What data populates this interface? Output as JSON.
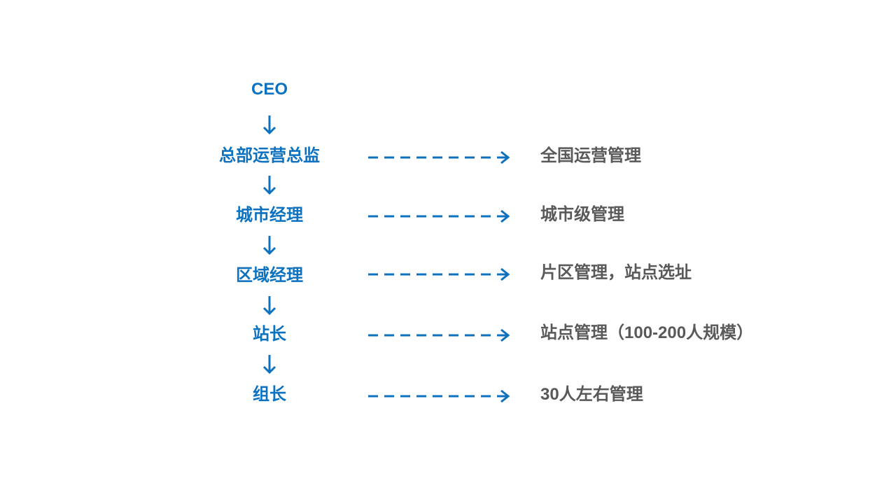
{
  "colors": {
    "role_text": "#0c72c0",
    "arrow": "#0c72c0",
    "description_text": "#595959",
    "background": "#ffffff"
  },
  "diagram": {
    "top_role": "CEO",
    "roles": [
      {
        "title": "总部运营总监",
        "description": "全国运营管理"
      },
      {
        "title": "城市经理",
        "description": "城市级管理"
      },
      {
        "title": "区域经理",
        "description": "片区管理，站点选址"
      },
      {
        "title": "站长",
        "description": "站点管理（100-200人规模）"
      },
      {
        "title": "组长",
        "description": "30人左右管理"
      }
    ]
  }
}
